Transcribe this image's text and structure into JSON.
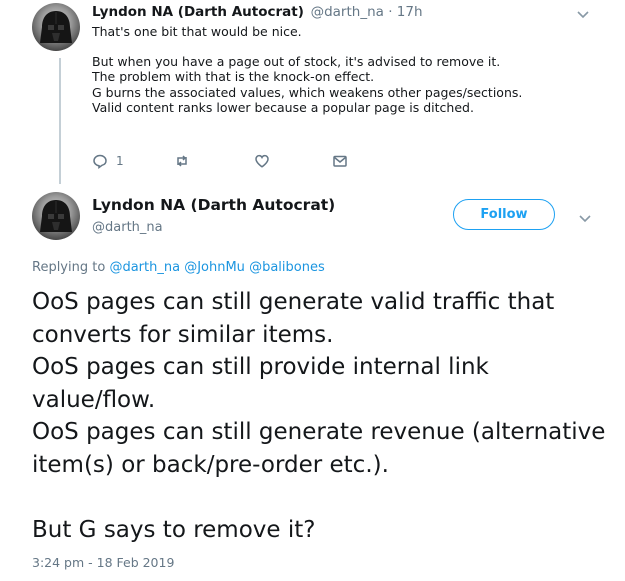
{
  "tweet1": {
    "author_name": "Lyndon NA (Darth Autocrat)",
    "meta": "@darth_na · 17h",
    "lines": [
      "That's one bit that would be nice.",
      "But when you have a page out of stock, it's advised to remove it.",
      "The problem with that is the knock-on effect.",
      "G burns the associated values, which weakens other pages/sections.",
      "Valid content ranks lower because a popular page is ditched."
    ],
    "reply_count": "1",
    "icons": [
      "reply-icon",
      "retweet-icon",
      "like-icon",
      "message-icon",
      "chevron-down-icon"
    ]
  },
  "tweet2": {
    "author_name": "Lyndon NA (Darth Autocrat)",
    "handle": "@darth_na",
    "follow_label": "Follow",
    "replying_to_label": "Replying to",
    "mentions": [
      "@darth_na",
      "@JohnMu",
      "@balibones"
    ],
    "text_lines": [
      "OoS pages can still generate valid traffic that converts for similar items.",
      "OoS pages can still provide internal link value/flow.",
      "OoS pages can still generate revenue (alternative item(s) or back/pre-order etc.).",
      "But G says to remove it?"
    ],
    "timestamp": "3:24 pm - 18 Feb 2019"
  },
  "colors": {
    "accent": "#1da1f2",
    "link": "#1b95e0",
    "secondary_text": "#657786",
    "primary_text": "#14171a",
    "thread_line": "#c4cfd6"
  }
}
